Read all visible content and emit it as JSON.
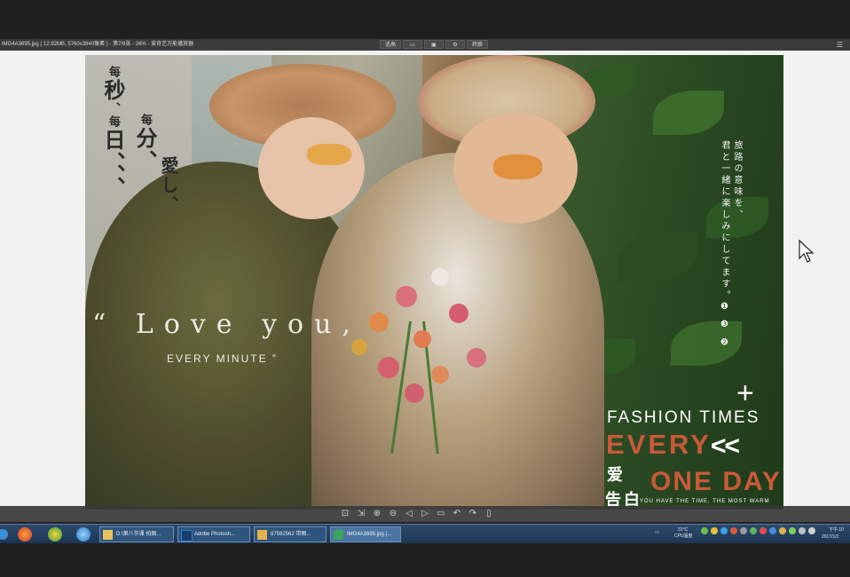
{
  "window": {
    "title": "IMG4A3695.jpg ( 12.92MB, 5760x3840像素 ) - 第7/8张 - 26% - 爱奇艺万能播放器",
    "toolbar_buttons": [
      "适高",
      "",
      "",
      "",
      "转换"
    ]
  },
  "photo": {
    "cn_text": {
      "col1": [
        "每",
        "秒",
        "、",
        "每",
        "日",
        "、",
        "、",
        "、"
      ],
      "col2": [
        "每",
        "分",
        "、"
      ],
      "col3": [
        "愛",
        "し",
        "、"
      ],
      "col1_text": "每秒、每日、、、",
      "col2_text": "每分、",
      "col3_text": "愛し、"
    },
    "love_quote": "“ Love you,",
    "every_minute": "EVERY MINUTE ”",
    "jp_col_1": "旅路の意味を、",
    "jp_col_2": "君と一緒に楽しみにしてます。",
    "jp_marks": "❶ ❸ ❷",
    "plus": "+",
    "fashion_times": "FASHION  TIMES",
    "every": "EVERY",
    "chevrons": "<<",
    "ai": "爱",
    "gaobai": "告白",
    "one_day": "ONE DAY",
    "small_en": "YOU HAVE THE TIME, THE MOST WARM"
  },
  "viewer_toolbar": {
    "icons": [
      "fit-icon",
      "actual-size-icon",
      "zoom-in-icon",
      "zoom-out-icon",
      "prev-icon",
      "next-icon",
      "slideshow-icon",
      "rotate-left-icon",
      "rotate-right-icon",
      "delete-icon"
    ]
  },
  "taskbar": {
    "tasks": [
      {
        "label": "D:\\第八节课 拍图...",
        "icon_color": "#e8c15a"
      },
      {
        "label": "Adobe Photosh...",
        "icon_color": "#2a7fd4"
      },
      {
        "label": "87592562 带图...",
        "icon_color": "#e3b44a"
      },
      {
        "label": "IMG4A3695.jpg (...",
        "icon_color": "#3aa55a"
      }
    ],
    "weather": "31°C",
    "weather_sub": "CPU温度",
    "clock_top": "下午 10",
    "clock_bottom": "2017/1/2"
  },
  "colors": {
    "accent_red": "#c85a3a",
    "taskbar": "#1d3554"
  }
}
